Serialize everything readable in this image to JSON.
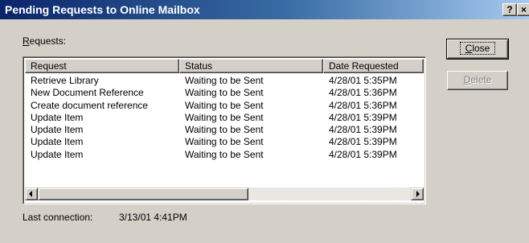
{
  "window": {
    "title": "Pending Requests to Online Mailbox",
    "help_glyph": "?",
    "close_glyph": "×"
  },
  "requests_label": {
    "accel": "R",
    "rest": "equests:"
  },
  "table": {
    "columns": [
      "Request",
      "Status",
      "Date Requested"
    ],
    "rows": [
      [
        "Retrieve Library",
        "Waiting to be Sent",
        "4/28/01 5:35PM"
      ],
      [
        "New Document Reference",
        "Waiting to be Sent",
        "4/28/01 5:36PM"
      ],
      [
        "Create document reference",
        "Waiting to be Sent",
        "4/28/01 5:36PM"
      ],
      [
        "Update Item",
        "Waiting to be Sent",
        "4/28/01 5:39PM"
      ],
      [
        "Update Item",
        "Waiting to be Sent",
        "4/28/01 5:39PM"
      ],
      [
        "Update Item",
        "Waiting to be Sent",
        "4/28/01 5:39PM"
      ],
      [
        "Update Item",
        "Waiting to be Sent",
        "4/28/01 5:39PM"
      ]
    ]
  },
  "buttons": {
    "close": {
      "accel": "C",
      "rest": "lose"
    },
    "delete": {
      "accel": "D",
      "rest": "elete",
      "enabled": false
    }
  },
  "last_connection": {
    "label": "Last connection:",
    "value": "3/13/01 4:41PM"
  }
}
